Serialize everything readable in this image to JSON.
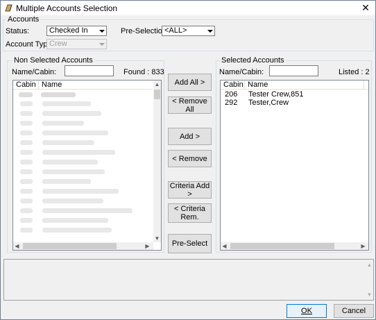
{
  "window": {
    "title": "Multiple Accounts Selection",
    "close_glyph": "✕"
  },
  "accounts": {
    "legend": "Accounts",
    "status_label": "Status:",
    "status_value": "Checked In",
    "preselection_label": "Pre-Selection:",
    "preselection_value": "<ALL>",
    "account_type_label": "Account Type:",
    "account_type_value": "Crew"
  },
  "non_selected": {
    "legend": "Non Selected Accounts",
    "name_cabin_label": "Name/Cabin:",
    "name_cabin_value": "",
    "found_label": "Found : 833",
    "columns": [
      "Cabin",
      "Name"
    ]
  },
  "selected": {
    "legend": "Selected Accounts",
    "name_cabin_label": "Name/Cabin:",
    "name_cabin_value": "",
    "listed_label": "Listed : 2",
    "columns": [
      "Cabin",
      "Name"
    ],
    "rows": [
      {
        "cabin": "206",
        "name": "Tester Crew,851"
      },
      {
        "cabin": "292",
        "name": "Tester,Crew"
      }
    ]
  },
  "buttons": {
    "add_all": "Add All >",
    "remove_all": "< Remove All",
    "add": "Add >",
    "remove": "< Remove",
    "criteria_add": "Criteria Add >",
    "criteria_rem_line1": "< Criteria",
    "criteria_rem_line2": "Rem.",
    "pre_select": "Pre-Select",
    "ok": "OK",
    "cancel": "Cancel"
  },
  "icons": {
    "app": "bookmark-pen-icon",
    "scroll_up": "▲",
    "scroll_down": "▼",
    "scroll_left": "◀",
    "scroll_right": "▶"
  },
  "colors": {
    "accent_border": "#0078d7",
    "selection": "#cce8ff"
  }
}
